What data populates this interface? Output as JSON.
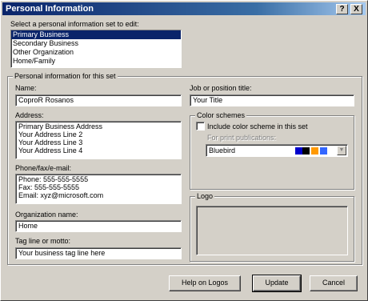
{
  "window": {
    "title": "Personal Information",
    "help_btn": "?",
    "close_btn": "X"
  },
  "selector": {
    "label": "Select a personal information set to edit:",
    "items": [
      "Primary Business",
      "Secondary Business",
      "Other Organization",
      "Home/Family"
    ],
    "selected_index": 0
  },
  "info_group": {
    "title": "Personal information for this set",
    "name_label": "Name:",
    "name_value": "CoproR Rosanos",
    "address_label": "Address:",
    "address_lines": [
      "Primary Business Address",
      "Your Address Line 2",
      "Your Address Line 3",
      "Your Address Line 4"
    ],
    "contact_label": "Phone/fax/e-mail:",
    "contact_lines": [
      "Phone: 555-555-5555",
      "Fax: 555-555-5555",
      "Email: xyz@microsoft.com"
    ],
    "org_label": "Organization name:",
    "org_value": "Home",
    "tagline_label": "Tag line or motto:",
    "tagline_value": "Your business tag line here",
    "job_label": "Job or position title:",
    "job_value": "Your Title"
  },
  "color_group": {
    "title": "Color schemes",
    "checkbox_label": "Include color scheme in this set",
    "checked": false,
    "print_label": "For print publications:",
    "scheme_value": "Bluebird",
    "swatch_colors": [
      "#0000cc",
      "#000000",
      "#ff9900",
      "#3366ff"
    ]
  },
  "logo_group": {
    "title": "Logo"
  },
  "buttons": {
    "help_logos": "Help on Logos",
    "update": "Update",
    "cancel": "Cancel"
  }
}
